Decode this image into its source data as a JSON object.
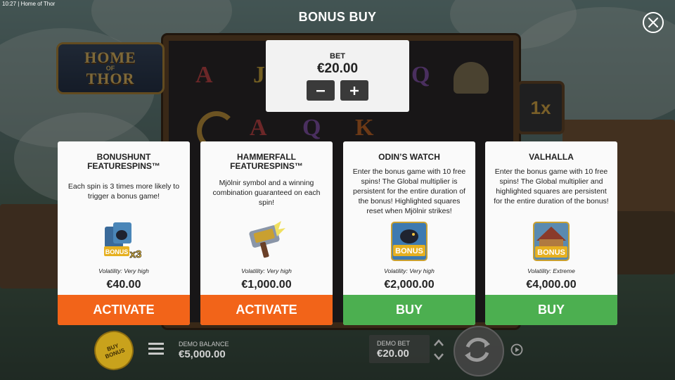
{
  "window": {
    "time": "10:27",
    "app_title": "Home of Thor"
  },
  "header": {
    "title": "BONUS BUY"
  },
  "bet": {
    "label": "BET",
    "value": "€20.00",
    "minus": "−",
    "plus": "+"
  },
  "background": {
    "logo_line1": "HOME",
    "logo_of": "OF",
    "logo_line2": "THOR",
    "multiplier": "1x",
    "reel_symbols": [
      "A",
      "J",
      "Q",
      "A",
      "Q",
      "K"
    ]
  },
  "cards": [
    {
      "title": "BONUSHUNT\nFEATURESPINS™",
      "description": "Each spin is 3 times more likely to trigger a bonus game!",
      "volatility": "Volatility: Very high",
      "price": "€40.00",
      "button": "ACTIVATE",
      "button_color": "#f26419",
      "icon": "raven-bonus-x3-icon",
      "icon_text": "BONUS",
      "icon_multiplier": "x3"
    },
    {
      "title": "HAMMERFALL\nFEATURESPINS™",
      "description": "Mjölnir symbol and a winning combination guaranteed on each spin!",
      "volatility": "Volatility: Very high",
      "price": "€1,000.00",
      "button": "ACTIVATE",
      "button_color": "#f26419",
      "icon": "mjolnir-hammer-icon"
    },
    {
      "title": "ODIN’S WATCH",
      "description": "Enter the bonus game with 10 free spins! The Global multiplier is persistent for the entire duration of the bonus! Highlighted squares reset when Mjölnir strikes!",
      "volatility": "Volatility: Very high",
      "price": "€2,000.00",
      "button": "BUY",
      "button_color": "#4caf50",
      "icon": "raven-bonus-icon",
      "icon_text": "BONUS"
    },
    {
      "title": "VALHALLA",
      "description": "Enter the bonus game with 10 free spins! The Global multiplier and highlighted squares are persistent for the entire duration of the bonus!",
      "volatility": "Volatility: Extreme",
      "price": "€4,000.00",
      "button": "BUY",
      "button_color": "#4caf50",
      "icon": "longhouse-bonus-icon",
      "icon_text": "BONUS"
    }
  ],
  "bottom_bar": {
    "buy_bonus": "BUY\nBONUS",
    "balance_label": "DEMO BALANCE",
    "balance_value": "€5,000.00",
    "bet_label": "DEMO BET",
    "bet_value": "€20.00"
  }
}
